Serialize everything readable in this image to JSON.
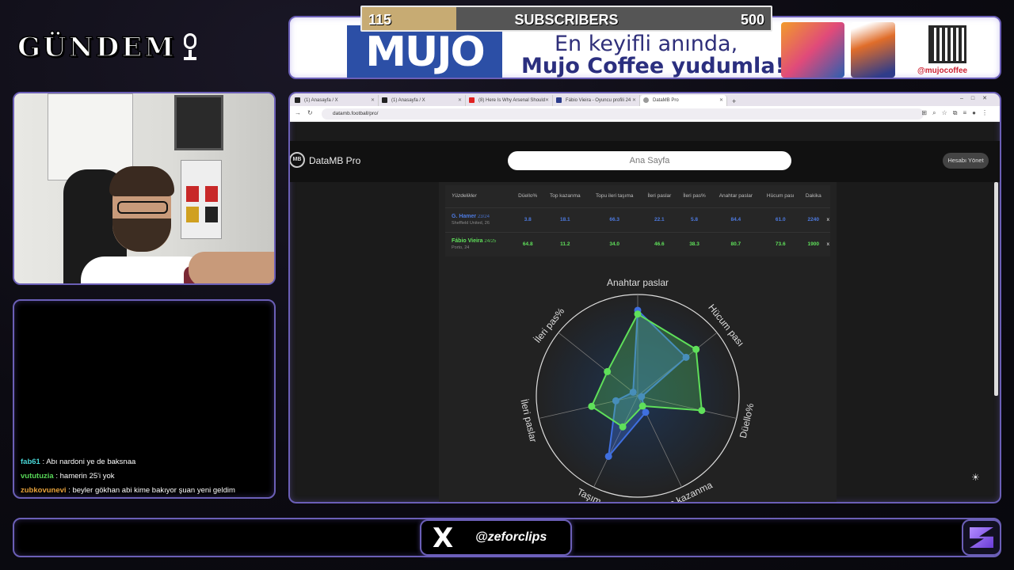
{
  "overlay": {
    "logo_text": "GÜNDEM",
    "subscribers": {
      "current": "115",
      "label": "SUBSCRIBERS",
      "goal": "500",
      "progress": 0.23
    },
    "ad": {
      "brand": "MUJO",
      "line1": "En keyifli anında,",
      "line2": "Mujo Coffee yudumla!",
      "handle": "@mujocoffee"
    },
    "social_handle": "@zeforclips"
  },
  "chat": [
    {
      "user": "fab61",
      "message": "Abı nardoni ye de baksnaa",
      "color": "#49d6d6"
    },
    {
      "user": "vututuzia",
      "message": "hamerin 25'i yok",
      "color": "#57d657"
    },
    {
      "user": "zubkovunevi",
      "message": "beyler gökhan abi kime bakıyor şuan yeni geldim",
      "color": "#e8a23a"
    }
  ],
  "browser": {
    "tabs": [
      {
        "title": "(1) Anasayfa / X",
        "active": false
      },
      {
        "title": "(1) Anasayfa / X",
        "active": false
      },
      {
        "title": "(8) Here Is Why Arsenal Should",
        "active": false
      },
      {
        "title": "Fábio Vieira - Oyuncu profili 24",
        "active": false
      },
      {
        "title": "DataMB Pro",
        "active": true
      }
    ],
    "new_tab": "+",
    "url": "datamb.football/pro/"
  },
  "site": {
    "name": "DataMB Pro",
    "logo": "MB",
    "search_placeholder": "Ana Sayfa",
    "account_button": "Hesabı Yönet"
  },
  "comparison": {
    "header_first": "Yüzdelikler",
    "columns": [
      "Düello%",
      "Top kazanma",
      "Topu ileri taşıma",
      "İleri paslar",
      "İleri pas%",
      "Anahtar paslar",
      "Hücum pası",
      "Dakika"
    ],
    "rows": [
      {
        "name": "G. Hamer",
        "season": "23/24",
        "club": "Sheffield United, 26",
        "values": [
          "3.8",
          "18.1",
          "66.3",
          "22.1",
          "5.8",
          "84.4",
          "61.0",
          "2240"
        ],
        "color": "blue",
        "remove": "x"
      },
      {
        "name": "Fábio Vieira",
        "season": "24/25",
        "club": "Porto, 24",
        "values": [
          "64.8",
          "11.2",
          "34.0",
          "46.6",
          "38.3",
          "80.7",
          "73.6",
          "1900"
        ],
        "color": "green",
        "remove": "x"
      }
    ]
  },
  "chart_data": {
    "type": "radar",
    "axes": [
      "Anahtar paslar",
      "Hücum pası",
      "Düello%",
      "Top kazanma",
      "Topu ileri taşıma",
      "İleri paslar",
      "İleri pas%"
    ],
    "visible_axis_labels": [
      "Anahtar paslar",
      "Hücum pası",
      "Düello%",
      "Top kazanma",
      "Taşım",
      "İleri paslar",
      "İleri pas%"
    ],
    "range": [
      0,
      100
    ],
    "series": [
      {
        "name": "G. Hamer",
        "color": "#3f6fe0",
        "values": [
          84.4,
          61.0,
          3.8,
          18.1,
          66.3,
          22.1,
          5.8
        ]
      },
      {
        "name": "Fábio Vieira",
        "color": "#5fe05a",
        "values": [
          80.7,
          73.6,
          64.8,
          11.2,
          34.0,
          46.6,
          38.3
        ]
      }
    ]
  },
  "theme_toggle_icon": "sun-icon"
}
